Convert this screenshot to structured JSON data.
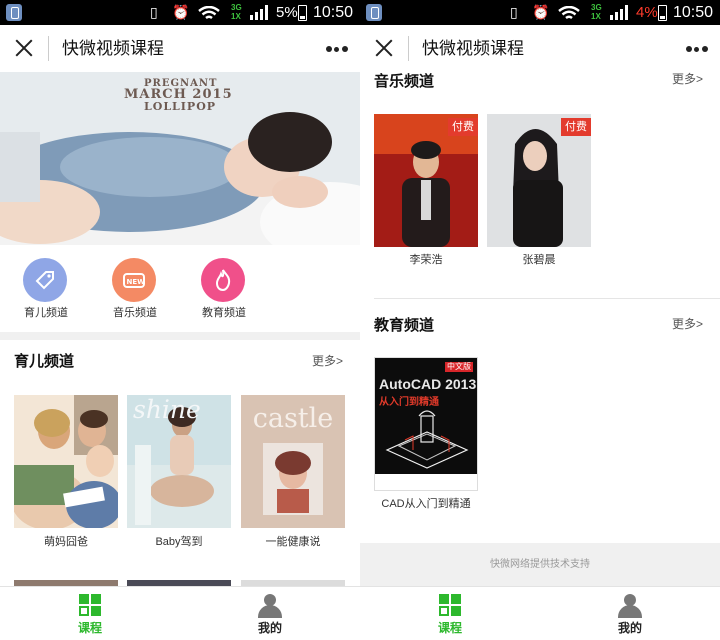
{
  "status_bar": {
    "left_battery_percent": "5%",
    "right_battery_percent": "4%",
    "time": "10:50",
    "network": "3G",
    "network_sub": "1X"
  },
  "nav": {
    "title": "快微视频课程"
  },
  "banner": {
    "line1": "PREGNANT",
    "line2": "MARCH 2015",
    "line3": "LOLLIPOP"
  },
  "channels": [
    {
      "label": "育儿频道",
      "icon": "tag-icon",
      "color": "#8fa6e6"
    },
    {
      "label": "音乐频道",
      "icon": "new-badge-icon",
      "color": "#f48a64"
    },
    {
      "label": "教育频道",
      "icon": "flame-icon",
      "color": "#f0508a"
    }
  ],
  "parenting": {
    "title": "育儿频道",
    "more": "更多>",
    "items": [
      {
        "caption": "萌妈囧爸"
      },
      {
        "caption": "Baby驾到",
        "cover_text": "shine"
      },
      {
        "caption": "一能健康说",
        "cover_text": "castle"
      }
    ]
  },
  "music": {
    "title": "音乐频道",
    "more": "更多>",
    "items": [
      {
        "caption": "李荣浩",
        "badge": "付费"
      },
      {
        "caption": "张碧晨",
        "badge": "付费"
      }
    ]
  },
  "education": {
    "title": "教育频道",
    "more": "更多>",
    "items": [
      {
        "caption": "CAD从入门到精通",
        "cover_title": "AutoCAD 2013",
        "cover_sub": "从入门到精通",
        "cover_tag": "中文版"
      }
    ]
  },
  "footer": {
    "text": "快微网络提供技术支持"
  },
  "tabbar": {
    "courses": "课程",
    "mine": "我的",
    "active_color": "#2db82d"
  }
}
